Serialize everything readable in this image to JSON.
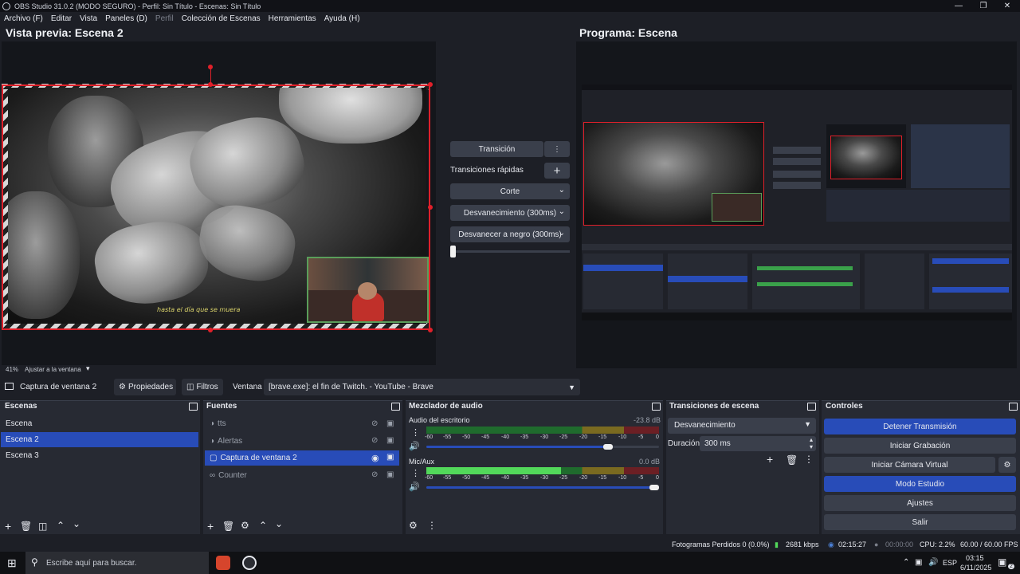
{
  "window": {
    "title": "OBS Studio 31.0.2 (MODO SEGURO) - Perfil: Sin Título - Escenas: Sin Título"
  },
  "menu": [
    "Archivo (F)",
    "Editar",
    "Vista",
    "Paneles (D)",
    "Perfil",
    "Colección de Escenas",
    "Herramientas",
    "Ayuda (H)"
  ],
  "preview": {
    "title": "Vista previa: Escena 2",
    "zoom": "41%",
    "fit_label": "Ajustar a la ventana",
    "overlay_text": "hasta el día que se muera"
  },
  "program": {
    "title": "Programa: Escena"
  },
  "transitions_panel": {
    "transition_button": "Transición",
    "quick_label": "Transiciones rápidas",
    "items": [
      "Corte",
      "Desvanecimiento (300ms)",
      "Desvanecer a negro (300ms)"
    ]
  },
  "source_toolbar": {
    "selected_source": "Captura de ventana 2",
    "properties": "Propiedades",
    "filters": "Filtros",
    "window_label": "Ventana",
    "window_value": "[brave.exe]: el fin de Twitch. - YouTube - Brave"
  },
  "scenes": {
    "title": "Escenas",
    "items": [
      "Escena",
      "Escena 2",
      "Escena 3"
    ],
    "selected": "Escena 2"
  },
  "sources": {
    "title": "Fuentes",
    "items": [
      "tts",
      "Alertas",
      "Captura de ventana 2",
      "Counter"
    ],
    "selected": "Captura de ventana 2"
  },
  "mixer": {
    "title": "Mezclador de audio",
    "channels": [
      {
        "name": "Audio del escritorio",
        "db": "-23.8 dB",
        "level": 0.72,
        "volume": 0.8
      },
      {
        "name": "Mic/Aux",
        "db": "0.0 dB",
        "level": 0.58,
        "volume": 1.0
      }
    ],
    "scale": [
      "-60",
      "-55",
      "-50",
      "-45",
      "-40",
      "-35",
      "-30",
      "-25",
      "-20",
      "-15",
      "-10",
      "-5",
      "0"
    ]
  },
  "scene_transitions": {
    "title": "Transiciones de escena",
    "selected": "Desvanecimiento",
    "duration_label": "Duración",
    "duration_value": "300 ms"
  },
  "controls": {
    "title": "Controles",
    "buttons": [
      "Detener Transmisión",
      "Iniciar Grabación",
      "Iniciar Cámara Virtual",
      "Modo Estudio",
      "Ajustes",
      "Salir"
    ]
  },
  "status": {
    "dropped": "Fotogramas Perdidos 0 (0.0%)",
    "bitrate": "2681 kbps",
    "stream_time": "02:15:27",
    "rec_time": "00:00:00",
    "cpu": "CPU: 2.2%",
    "fps": "60.00 / 60.00 FPS"
  },
  "taskbar": {
    "search_placeholder": "Escribe aquí para buscar.",
    "lang": "ESP",
    "time": "03:15",
    "date": "6/11/2025",
    "notification_count": "2"
  },
  "colors": {
    "accent": "#284cb8",
    "panel": "#272a33",
    "bg": "#1d1f26",
    "selection_red": "#e0202a"
  }
}
